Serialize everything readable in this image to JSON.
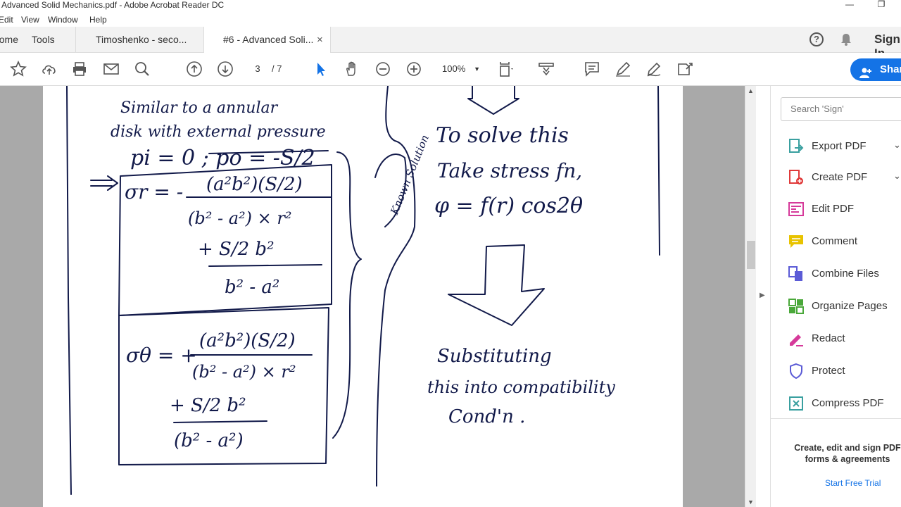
{
  "window": {
    "title": "Advanced Solid Mechanics.pdf - Adobe Acrobat Reader DC",
    "minimize": "—",
    "restore": "❐"
  },
  "menu": [
    "Edit",
    "View",
    "Window",
    "Help"
  ],
  "tabs": {
    "home": "Home",
    "tools": "Tools",
    "doc1": "Timoshenko - seco...",
    "doc2": "#6 - Advanced Soli...",
    "close": "×"
  },
  "header": {
    "sign_in": "Sign In",
    "help": "?"
  },
  "toolbar": {
    "page_current": "3",
    "page_total": "/ 7",
    "zoom": "100%",
    "share": "Share"
  },
  "panel": {
    "search_placeholder": "Search 'Sign'",
    "items": [
      {
        "label": "Export PDF",
        "icon": "export-pdf-icon",
        "color": "#3aa0a0",
        "expand": "⌄"
      },
      {
        "label": "Create PDF",
        "icon": "create-pdf-icon",
        "color": "#e03a3a",
        "expand": "⌄"
      },
      {
        "label": "Edit PDF",
        "icon": "edit-pdf-icon",
        "color": "#d63a9a"
      },
      {
        "label": "Comment",
        "icon": "comment-icon",
        "color": "#e8c300"
      },
      {
        "label": "Combine Files",
        "icon": "combine-files-icon",
        "color": "#5b5bd6"
      },
      {
        "label": "Organize Pages",
        "icon": "organize-pages-icon",
        "color": "#4aa83a"
      },
      {
        "label": "Redact",
        "icon": "redact-icon",
        "color": "#d63a9a"
      },
      {
        "label": "Protect",
        "icon": "protect-icon",
        "color": "#5b5bd6"
      },
      {
        "label": "Compress PDF",
        "icon": "compress-pdf-icon",
        "color": "#3aa0a0"
      }
    ],
    "promo_text": "Create, edit and sign PDF forms & agreements",
    "trial_link": "Start Free Trial"
  },
  "document": {
    "notes": {
      "left_intro_1": "Similar to a annular",
      "left_intro_2": "disk with external pressure",
      "bc": "pi = 0 ; po = -S/2",
      "arrow": "=>",
      "sigma_r_lhs": "σr = -",
      "sigma_r_num": "(a²b²)(S/2)",
      "sigma_r_den": "(b² - a²) × r²",
      "sigma_r_term2": "+ S/2 b²",
      "sigma_r_term2_den": "b² - a²",
      "sigma_t_lhs": "σθ = +",
      "sigma_t_num": "(a²b²)(S/2)",
      "sigma_t_den": "(b² - a²) × r²",
      "sigma_t_term2": "+ S/2 b²",
      "sigma_t_term2_den": "(b² - a²)",
      "known": "Known Solution",
      "right_1": "To solve this",
      "right_2": "Take stress fn,",
      "right_3": "φ = f(r) cos2θ",
      "right_4": "Substituting",
      "right_5": "this into compatibility",
      "right_6": "Cond'n ."
    }
  }
}
